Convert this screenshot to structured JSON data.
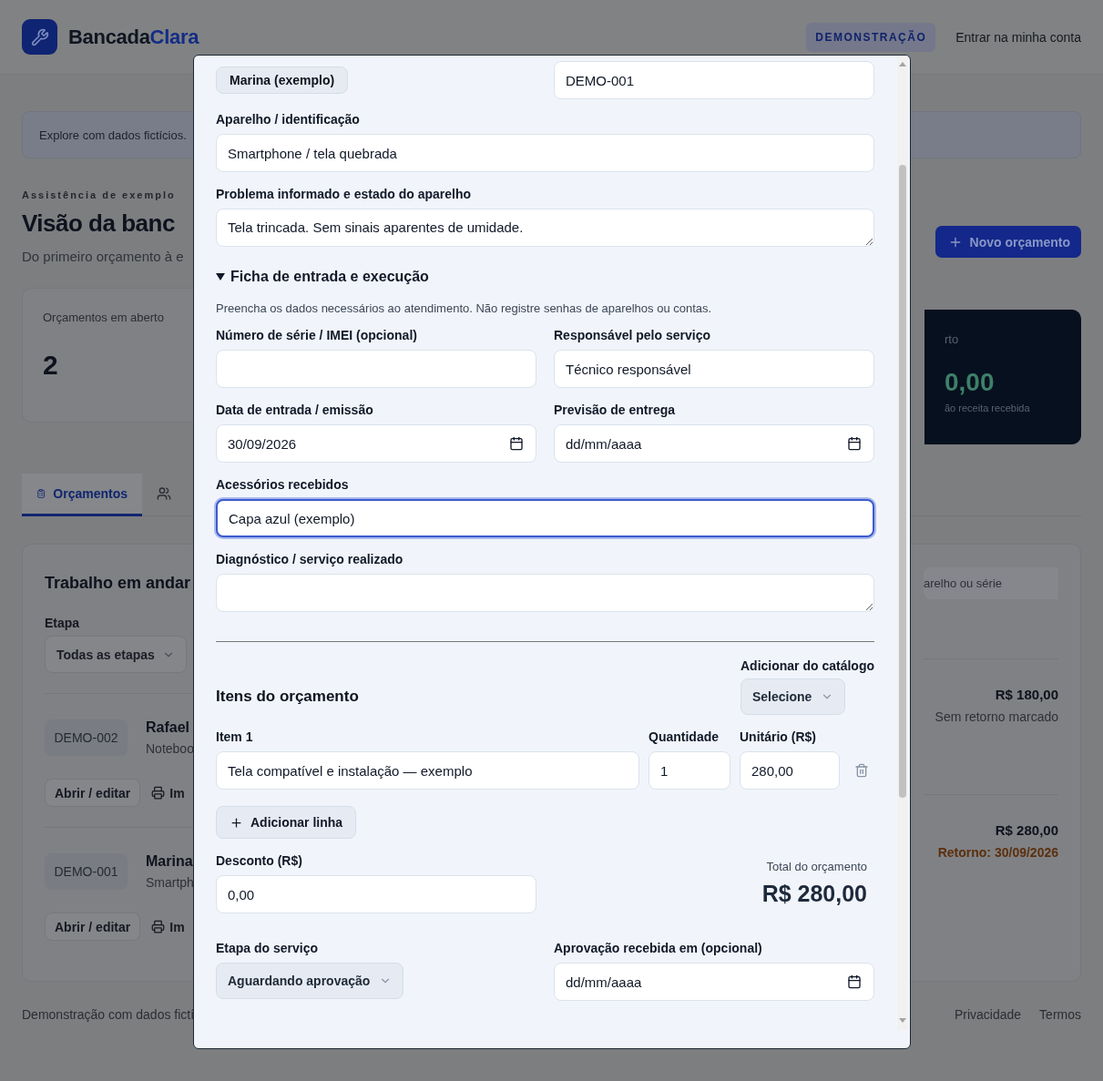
{
  "header": {
    "brand_first": "Bancada",
    "brand_second": "Clara",
    "badge": "DEMONSTRAÇÃO",
    "login": "Entrar na minha conta"
  },
  "banner": "Explore com dados fictícios.",
  "page": {
    "eyebrow": "Assistência de exemplo",
    "title": "Visão da banc",
    "subtitle": "Do primeiro orçamento à e",
    "new_button": "Novo orçamento"
  },
  "stats": [
    {
      "kind": "light",
      "label": "Orçamentos em aberto",
      "value": "2"
    },
    {
      "kind": "dark",
      "label": "rto",
      "value": "0,00",
      "note": "ão receita recebida"
    }
  ],
  "tabs": [
    {
      "label": "Orçamentos",
      "selected": true
    },
    {
      "selected": false
    }
  ],
  "panel": {
    "title": "Trabalho em andar",
    "filter_label": "Etapa",
    "filter_value": "Todas as etapas",
    "search_placeholder": "arelho ou série",
    "orders": [
      {
        "code": "DEMO-002",
        "client": "Rafael",
        "device": "Noteboo",
        "open_button": "Abrir / editar",
        "print_button": "Im",
        "amount": "R$ 180,00",
        "return": "Sem retorno marcado",
        "return_scheduled": false
      },
      {
        "code": "DEMO-001",
        "client": "Marina",
        "device": "Smartph",
        "open_button": "Abrir / editar",
        "print_button": "Im",
        "amount": "R$ 280,00",
        "return": "Retorno: 30/09/2026",
        "return_scheduled": true
      }
    ]
  },
  "footer": {
    "left": "Demonstração com dados fictí",
    "links": [
      "Privacidade",
      "Termos"
    ]
  },
  "modal": {
    "customer_chip": "Marina (exemplo)",
    "code_value": "DEMO-001",
    "device": {
      "label": "Aparelho / identificação",
      "value": "Smartphone / tela quebrada"
    },
    "problem": {
      "label": "Problema informado e estado do aparelho",
      "value": "Tela trincada. Sem sinais aparentes de umidade."
    },
    "intake": {
      "summary": "Ficha de entrada e execução",
      "expanded": true,
      "hint": "Preencha os dados necessários ao atendimento. Não registre senhas de aparelhos ou contas.",
      "fields": [
        {
          "kind": "text",
          "label": "Número de série / IMEI (opcional)",
          "focused": false
        },
        {
          "kind": "text",
          "label": "Responsável pelo serviço",
          "value": "Técnico responsável",
          "focused": false
        },
        {
          "kind": "date",
          "label": "Data de entrada / emissão",
          "value": "30/09/2026",
          "focused": false
        },
        {
          "kind": "date",
          "label": "Previsão de entrega",
          "placeholder": "dd/mm/aaaa",
          "focused": false
        },
        {
          "kind": "line",
          "label": "Acessórios recebidos",
          "value": "Capa azul (exemplo)",
          "focused": true
        },
        {
          "kind": "note",
          "label": "Diagnóstico / serviço realizado",
          "focused": false
        }
      ]
    },
    "items": {
      "title": "Itens do orçamento",
      "catalog_label": "Adicionar do catálogo",
      "catalog_value": "Selecione",
      "quantity_label": "Quantidade",
      "unit_label": "Unitário (R$)",
      "rows": [
        {
          "label": "Item 1",
          "description": "Tela compatível e instalação — exemplo",
          "quantity": "1",
          "unit_price": "280,00"
        }
      ],
      "add_button": "Adicionar linha"
    },
    "discount": {
      "label": "Desconto (R$)",
      "value": "0,00"
    },
    "total": {
      "label": "Total do orçamento",
      "value": "R$ 280,00"
    },
    "stage": {
      "label": "Etapa do serviço",
      "value": "Aguardando aprovação"
    },
    "approval": {
      "label": "Aprovação recebida em (opcional)",
      "placeholder": "dd/mm/aaaa"
    }
  }
}
